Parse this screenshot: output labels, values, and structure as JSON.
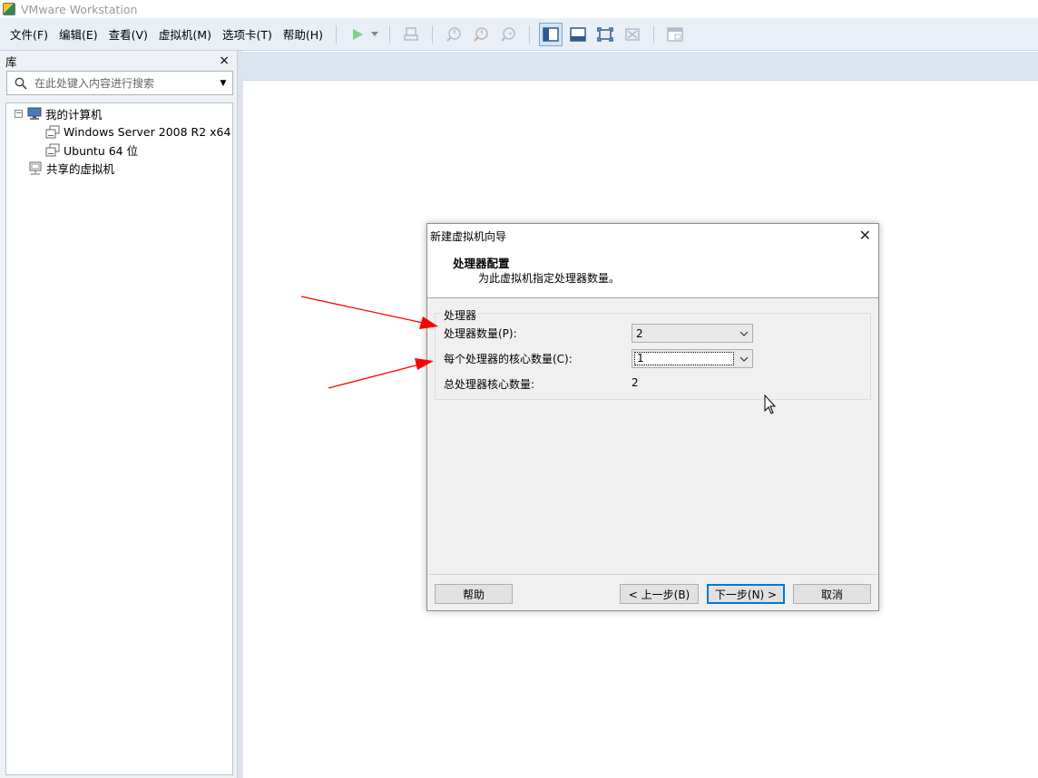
{
  "window": {
    "title": "VMware Workstation"
  },
  "menu": {
    "items": [
      "文件(F)",
      "编辑(E)",
      "查看(V)",
      "虚拟机(M)",
      "选项卡(T)",
      "帮助(H)"
    ]
  },
  "toolbar": {
    "icons": [
      "play-icon",
      "dropdown-icon",
      "send-keys-icon",
      "snapshot-icon",
      "revert-snapshot-icon",
      "snapshot-manager-icon",
      "show-library-icon",
      "thumbnail-bar-icon",
      "fullscreen-icon",
      "unity-icon",
      "console-view-icon"
    ]
  },
  "library": {
    "title": "库",
    "close": "×",
    "search_placeholder": "在此处键入内容进行搜索",
    "tree": {
      "root": "我的计算机",
      "root_expander": "−",
      "vms": [
        "Windows Server 2008 R2 x64",
        "Ubuntu 64 位"
      ],
      "shared": "共享的虚拟机"
    }
  },
  "dialog": {
    "title": "新建虚拟机向导",
    "close": "✕",
    "heading": "处理器配置",
    "subheading": "为此虚拟机指定处理器数量。",
    "group_label": "处理器",
    "processors_label": "处理器数量(P):",
    "processors_value": "2",
    "cores_label": "每个处理器的核心数量(C):",
    "cores_value": "1",
    "total_label": "总处理器核心数量:",
    "total_value": "2",
    "buttons": {
      "help": "帮助",
      "back": "< 上一步(B)",
      "next": "下一步(N) >",
      "cancel": "取消"
    }
  },
  "colors": {
    "toolbar_bg": "#e8eff7",
    "accent": "#0078d7",
    "annotation_arrow": "#ff0000",
    "play": "#3cb44b"
  }
}
